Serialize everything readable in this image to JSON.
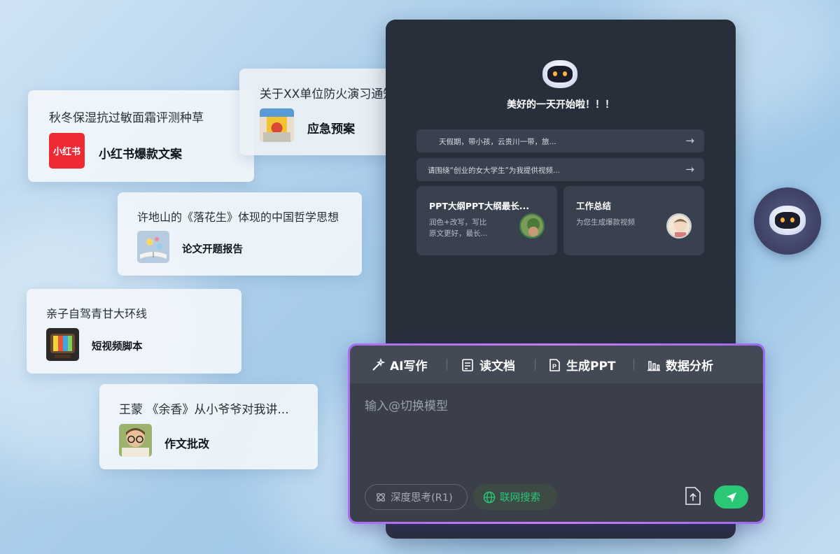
{
  "cards": [
    {
      "title": "秋冬保湿抗过敏面霜评测种草",
      "label": "小红书爆款文案",
      "thumb_text": "小红书"
    },
    {
      "title": "关于XX单位防火演习通知",
      "label": "应急预案"
    },
    {
      "title": "许地山的《落花生》体现的中国哲学思想",
      "label": "论文开题报告"
    },
    {
      "title": "亲子自驾青甘大环线",
      "label": "短视频脚本"
    },
    {
      "title": "王蒙 《余香》从小爷爷对我讲...",
      "label": "作文批改"
    }
  ],
  "panel": {
    "greeting": "美好的一天开始啦！！！",
    "prompts": [
      {
        "text": "天假期，带小孩，云贵川一带，旅...",
        "arrow": "→"
      },
      {
        "text": "请围绕“创业的女大学生”为我提供视频...",
        "arrow": "→"
      }
    ],
    "tiles": [
      {
        "title": "PPT大纲PPT大纲最长...",
        "sub": "润色+改写，写比原文更好，最长..."
      },
      {
        "title": "工作总结",
        "sub": "为您生成爆款视频"
      }
    ]
  },
  "composer": {
    "tools": [
      "AI写作",
      "读文档",
      "生成PPT",
      "数据分析"
    ],
    "placeholder": "输入@切换模型",
    "deep_think": "深度思考(R1)",
    "web_search": "联网搜索"
  },
  "colors": {
    "accent_green": "#29c776",
    "border_purple": "#b877f3",
    "panel_bg": "#272f3b"
  }
}
